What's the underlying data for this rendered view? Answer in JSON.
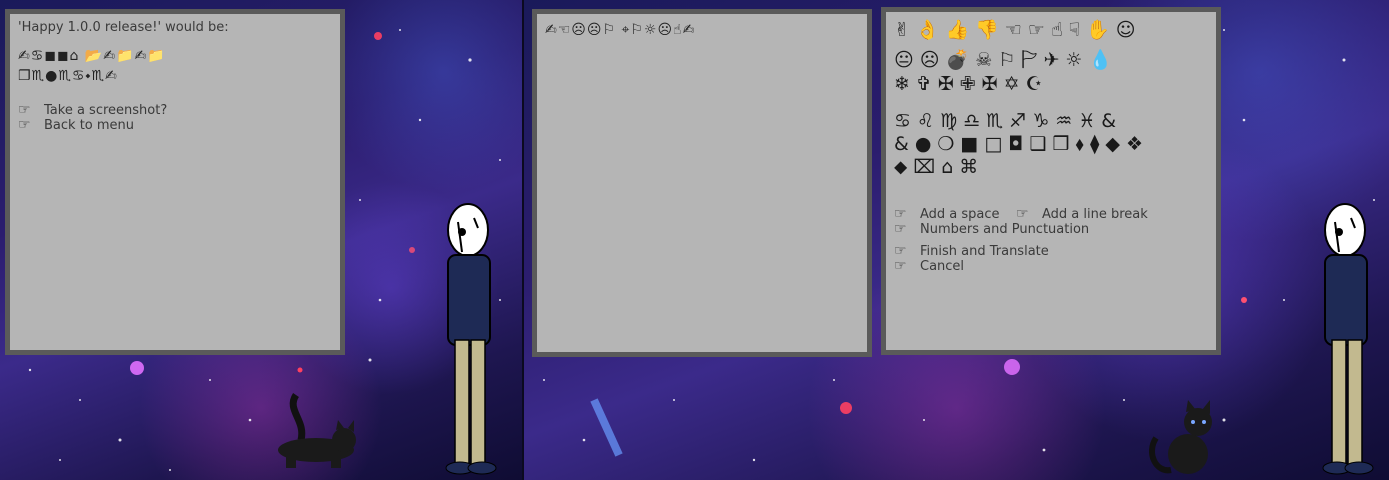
{
  "left_panel": {
    "heading": "'Happy 1.0.0 release!' would be:",
    "glyph_line1": "✍♋◼◼⌂    📂✍📁✍📁",
    "glyph_line2": "❐♏●♏♋⬩♏✍",
    "menu": [
      {
        "icon": "☞",
        "label": "Take a screenshot?"
      },
      {
        "icon": "☞",
        "label": "Back to menu"
      }
    ]
  },
  "middle_panel": {
    "glyph_text": "✍☜☹☹⚐   ⌖⚐☼☹☝✍"
  },
  "right_panel": {
    "symbol_rows": [
      "✌👌👍👎☜☞☝☟✋☺",
      "😐☹💣☠⚐🏱✈☼💧",
      "❄✞✠✙✠✡☪",
      "♋♌♍♎♏♐♑♒♓&",
      "&●❍■□◘❑❒⬧⧫◆❖",
      "⬥⌧⌂⌘"
    ],
    "actions_row1": [
      {
        "icon": "☞",
        "label": "Add a space"
      },
      {
        "icon": "☞",
        "label": "Add a line break"
      }
    ],
    "actions_row2": [
      {
        "icon": "☞",
        "label": "Numbers and Punctuation"
      }
    ],
    "actions_row3": [
      {
        "icon": "☞",
        "label": "Finish and Translate"
      },
      {
        "icon": "☞",
        "label": "Cancel"
      }
    ]
  },
  "colors": {
    "panel_bg": "#b5b5b5",
    "panel_border": "#5a5a5a",
    "text": "#3a3a3a"
  }
}
